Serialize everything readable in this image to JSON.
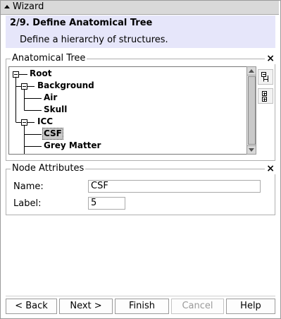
{
  "window": {
    "title": "Wizard"
  },
  "header": {
    "step": "2/9. Define Anatomical Tree",
    "description": "Define a hierarchy of structures."
  },
  "tree_panel": {
    "legend": "Anatomical Tree",
    "close_glyph": "×",
    "nodes": [
      {
        "label": "Root",
        "depth": 0,
        "expanded": true
      },
      {
        "label": "Background",
        "depth": 1,
        "expanded": true
      },
      {
        "label": "Air",
        "depth": 2
      },
      {
        "label": "Skull",
        "depth": 2
      },
      {
        "label": "ICC",
        "depth": 1,
        "expanded": true
      },
      {
        "label": "CSF",
        "depth": 2,
        "selected": true
      },
      {
        "label": "Grey Matter",
        "depth": 2
      }
    ],
    "side_buttons": [
      "collapse-tree-icon",
      "expand-tree-icon"
    ]
  },
  "attributes_panel": {
    "legend": "Node Attributes",
    "close_glyph": "×",
    "name_label": "Name:",
    "name_value": "CSF",
    "label_label": "Label:",
    "label_value": "5"
  },
  "buttons": {
    "back": "< Back",
    "next": "Next >",
    "finish": "Finish",
    "cancel": "Cancel",
    "help": "Help"
  },
  "colors": {
    "header_bg": "#e6e6fa",
    "titlebar_bg": "#d9d9d9",
    "selection_bg": "#c8c8c8"
  }
}
